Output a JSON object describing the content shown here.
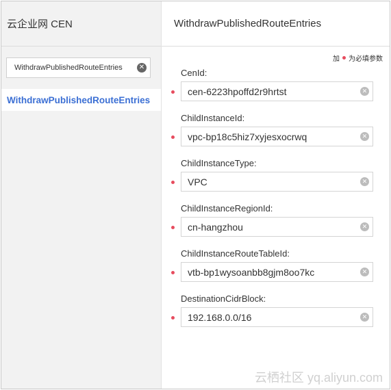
{
  "sidebar": {
    "title": "云企业网 CEN",
    "search_value": "WithdrawPublishedRouteEntries",
    "items": [
      {
        "label": "WithdrawPublishedRouteEntries",
        "active": true
      }
    ]
  },
  "main": {
    "title": "WithdrawPublishedRouteEntries",
    "legend": {
      "prefix": "加",
      "suffix": "为必填参数"
    },
    "fields": [
      {
        "label": "CenId:",
        "value": "cen-6223hpoffd2r9hrtst",
        "required": true
      },
      {
        "label": "ChildInstanceId:",
        "value": "vpc-bp18c5hiz7xyjesxocrwq",
        "required": true
      },
      {
        "label": "ChildInstanceType:",
        "value": "VPC",
        "required": true
      },
      {
        "label": "ChildInstanceRegionId:",
        "value": "cn-hangzhou",
        "required": true
      },
      {
        "label": "ChildInstanceRouteTableId:",
        "value": "vtb-bp1wysoanbb8gjm8oo7kc",
        "required": true
      },
      {
        "label": "DestinationCidrBlock:",
        "value": "192.168.0.0/16",
        "required": true
      }
    ]
  },
  "watermark": "云栖社区 yq.aliyun.com",
  "colors": {
    "accent": "#3b6fd4",
    "required": "#e74c5e",
    "sidebar_bg": "#f2f2f2"
  }
}
